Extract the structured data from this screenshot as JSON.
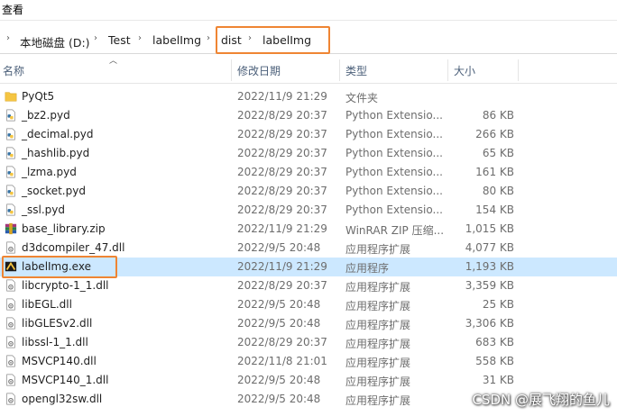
{
  "window": {
    "menu_label": "查看"
  },
  "breadcrumb": {
    "items": [
      "本地磁盘 (D:)",
      "Test",
      "labelImg",
      "dist",
      "labelImg"
    ]
  },
  "columns": {
    "name": "名称",
    "date": "修改日期",
    "type": "类型",
    "size": "大小"
  },
  "files": [
    {
      "icon": "folder-icon",
      "name": "PyQt5",
      "date": "2022/11/9 21:29",
      "type": "文件夹",
      "size": ""
    },
    {
      "icon": "python-file-icon",
      "name": "_bz2.pyd",
      "date": "2022/8/29 20:37",
      "type": "Python Extensio...",
      "size": "86 KB"
    },
    {
      "icon": "python-file-icon",
      "name": "_decimal.pyd",
      "date": "2022/8/29 20:37",
      "type": "Python Extensio...",
      "size": "266 KB"
    },
    {
      "icon": "python-file-icon",
      "name": "_hashlib.pyd",
      "date": "2022/8/29 20:37",
      "type": "Python Extensio...",
      "size": "65 KB"
    },
    {
      "icon": "python-file-icon",
      "name": "_lzma.pyd",
      "date": "2022/8/29 20:37",
      "type": "Python Extensio...",
      "size": "161 KB"
    },
    {
      "icon": "python-file-icon",
      "name": "_socket.pyd",
      "date": "2022/8/29 20:37",
      "type": "Python Extensio...",
      "size": "80 KB"
    },
    {
      "icon": "python-file-icon",
      "name": "_ssl.pyd",
      "date": "2022/8/29 20:37",
      "type": "Python Extensio...",
      "size": "154 KB"
    },
    {
      "icon": "zip-archive-icon",
      "name": "base_library.zip",
      "date": "2022/11/9 21:29",
      "type": "WinRAR ZIP 压缩...",
      "size": "1,015 KB"
    },
    {
      "icon": "dll-file-icon",
      "name": "d3dcompiler_47.dll",
      "date": "2022/9/5 20:48",
      "type": "应用程序扩展",
      "size": "4,077 KB"
    },
    {
      "icon": "exe-app-icon",
      "name": "labelImg.exe",
      "date": "2022/11/9 21:29",
      "type": "应用程序",
      "size": "1,193 KB",
      "selected": true
    },
    {
      "icon": "dll-file-icon",
      "name": "libcrypto-1_1.dll",
      "date": "2022/8/29 20:37",
      "type": "应用程序扩展",
      "size": "3,359 KB"
    },
    {
      "icon": "dll-file-icon",
      "name": "libEGL.dll",
      "date": "2022/9/5 20:48",
      "type": "应用程序扩展",
      "size": "25 KB"
    },
    {
      "icon": "dll-file-icon",
      "name": "libGLESv2.dll",
      "date": "2022/9/5 20:48",
      "type": "应用程序扩展",
      "size": "3,306 KB"
    },
    {
      "icon": "dll-file-icon",
      "name": "libssl-1_1.dll",
      "date": "2022/8/29 20:37",
      "type": "应用程序扩展",
      "size": "683 KB"
    },
    {
      "icon": "dll-file-icon",
      "name": "MSVCP140.dll",
      "date": "2022/11/8 21:01",
      "type": "应用程序扩展",
      "size": "558 KB"
    },
    {
      "icon": "dll-file-icon",
      "name": "MSVCP140_1.dll",
      "date": "2022/9/5 20:48",
      "type": "应用程序扩展",
      "size": "31 KB"
    },
    {
      "icon": "dll-file-icon",
      "name": "opengl32sw.dll",
      "date": "2022/9/5 20:48",
      "type": "应用程序扩展",
      "size": ""
    }
  ],
  "watermark": "CSDN @展飞翔的鱼儿",
  "colors": {
    "selection": "#cce8ff",
    "annotation_orange": "#ef8533",
    "folder_yellow": "#f5c542"
  }
}
